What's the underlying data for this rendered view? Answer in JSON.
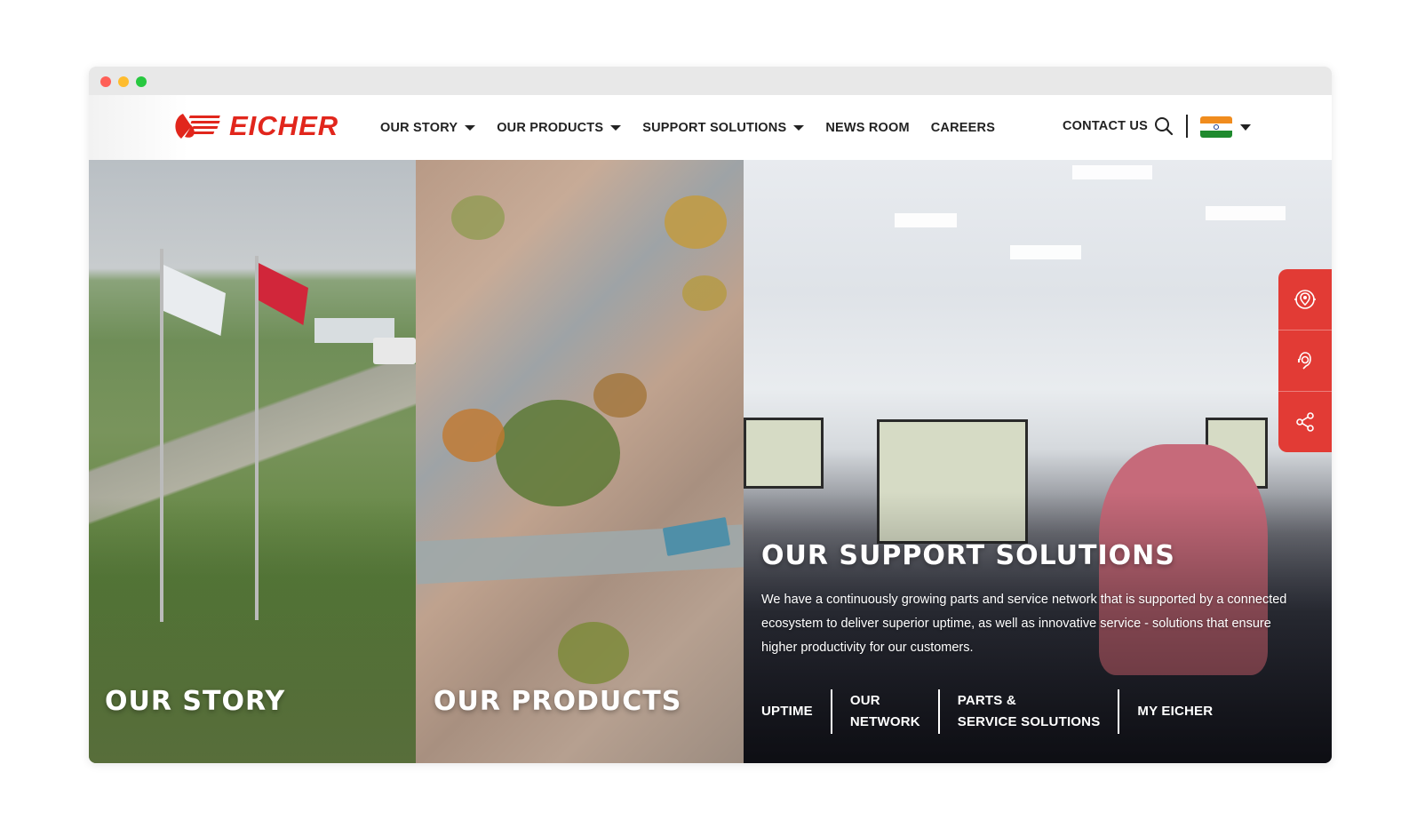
{
  "brand": {
    "name": "EICHER",
    "color": "#e1261c"
  },
  "nav": {
    "items": [
      {
        "label": "OUR STORY",
        "has_dropdown": true
      },
      {
        "label": "OUR PRODUCTS",
        "has_dropdown": true
      },
      {
        "label": "SUPPORT SOLUTIONS",
        "has_dropdown": true
      },
      {
        "label": "NEWS ROOM",
        "has_dropdown": false
      },
      {
        "label": "CAREERS",
        "has_dropdown": false
      }
    ],
    "contact_label": "CONTACT US",
    "search_icon": "search-icon",
    "country": "India"
  },
  "panels": {
    "story": {
      "title": "OUR STORY"
    },
    "products": {
      "title": "OUR PRODUCTS"
    },
    "support": {
      "title": "OUR SUPPORT SOLUTIONS",
      "description": "We have a continuously growing parts and service network that is supported by a connected ecosystem to deliver superior uptime, as well as innovative service - solutions that ensure higher productivity for our customers.",
      "links": [
        {
          "line1": "UPTIME",
          "line2": ""
        },
        {
          "line1": "OUR",
          "line2": "NETWORK"
        },
        {
          "line1": "PARTS &",
          "line2": "SERVICE SOLUTIONS"
        },
        {
          "line1": "MY EICHER",
          "line2": ""
        }
      ]
    }
  },
  "side_widget": {
    "color": "#e23b35",
    "buttons": [
      "location-icon",
      "support-agent-icon",
      "share-icon"
    ]
  }
}
